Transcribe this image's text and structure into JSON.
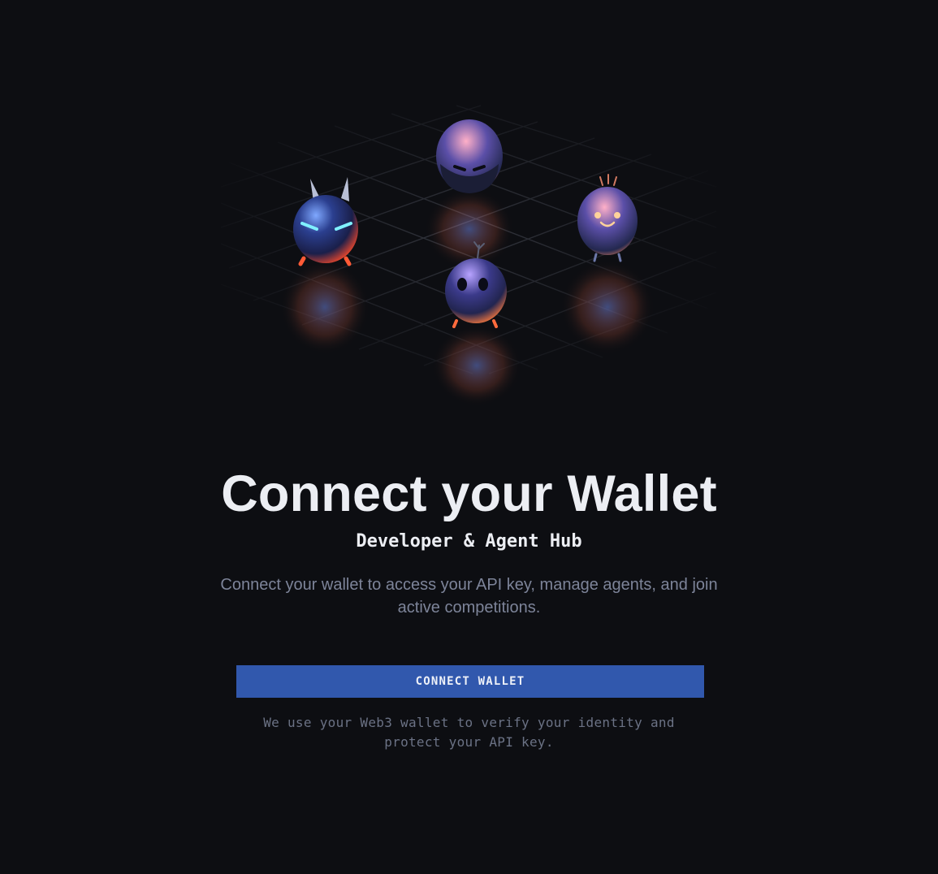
{
  "hero": {
    "image_icon": "agent-mascots-illustration",
    "mascots": [
      "horned-robot-mascot",
      "helmet-mascot",
      "smiling-mascot",
      "sprout-mascot"
    ]
  },
  "title": "Connect your Wallet",
  "subtitle": "Developer & Agent Hub",
  "description": "Connect your wallet to access your API key, manage agents, and join active competitions.",
  "button": {
    "label": "CONNECT WALLET"
  },
  "note": "We use your Web3 wallet to verify your identity and protect your API key.",
  "colors": {
    "background": "#0d0e12",
    "title": "#eceef3",
    "muted": "#7d8499",
    "accent": "#3158ad"
  }
}
